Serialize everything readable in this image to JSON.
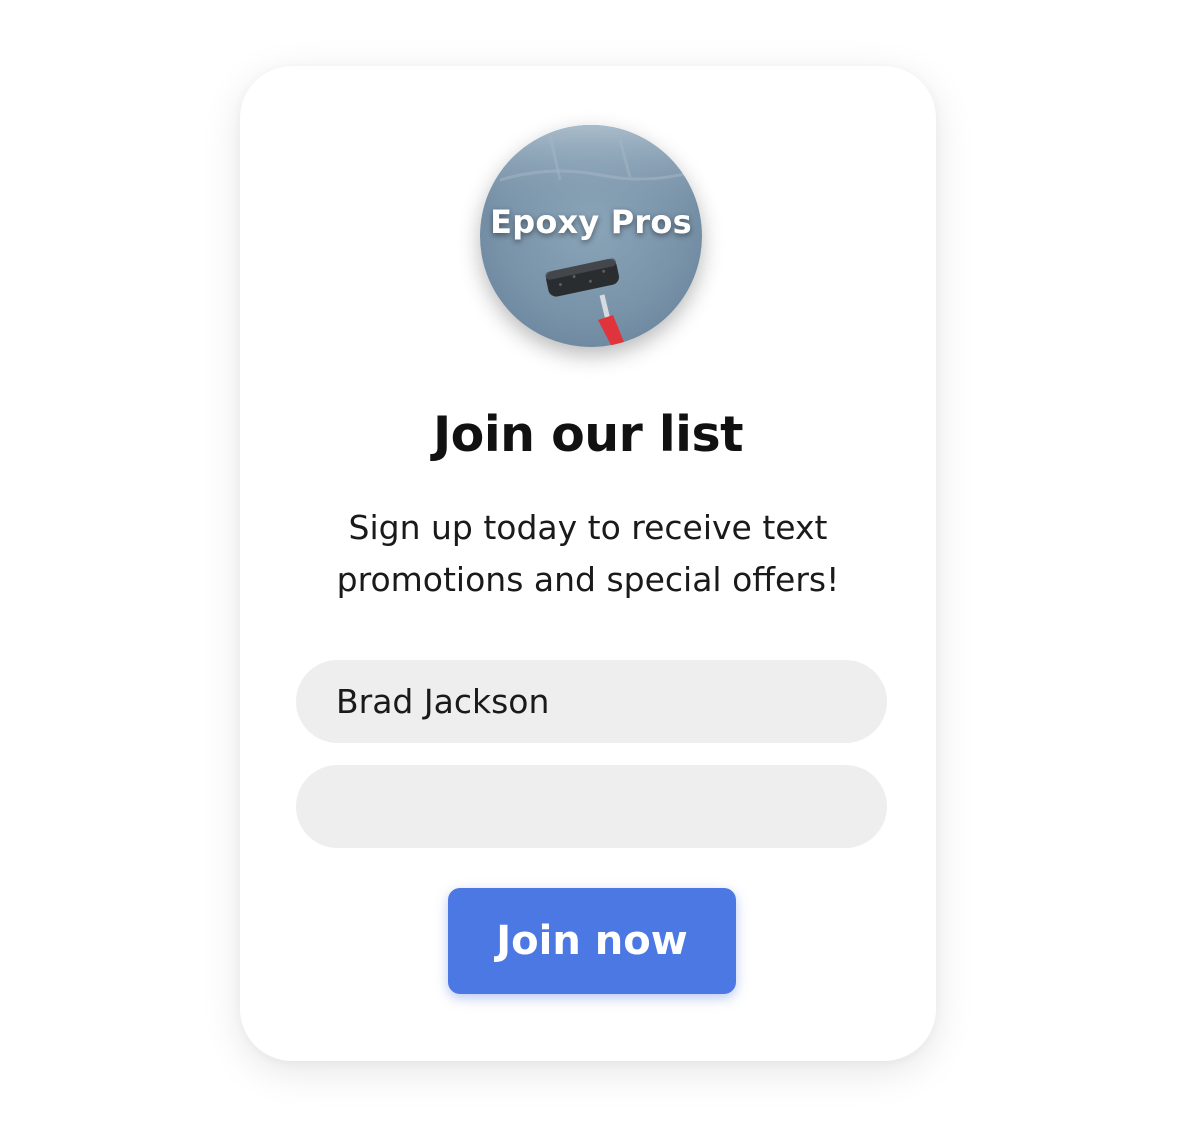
{
  "logo": {
    "text": "Epoxy Pros",
    "icon": "paint-roller-icon"
  },
  "title": "Join our list",
  "subtitle": "Sign up today to receive text promotions and special offers!",
  "form": {
    "name_value": "Brad Jackson",
    "phone_value": ""
  },
  "button": {
    "label": "Join now"
  },
  "colors": {
    "accent": "#4c78e4",
    "field_bg": "#eeeeee",
    "logo_bg": "#7e98ad",
    "roller_handle": "#e0343d"
  }
}
